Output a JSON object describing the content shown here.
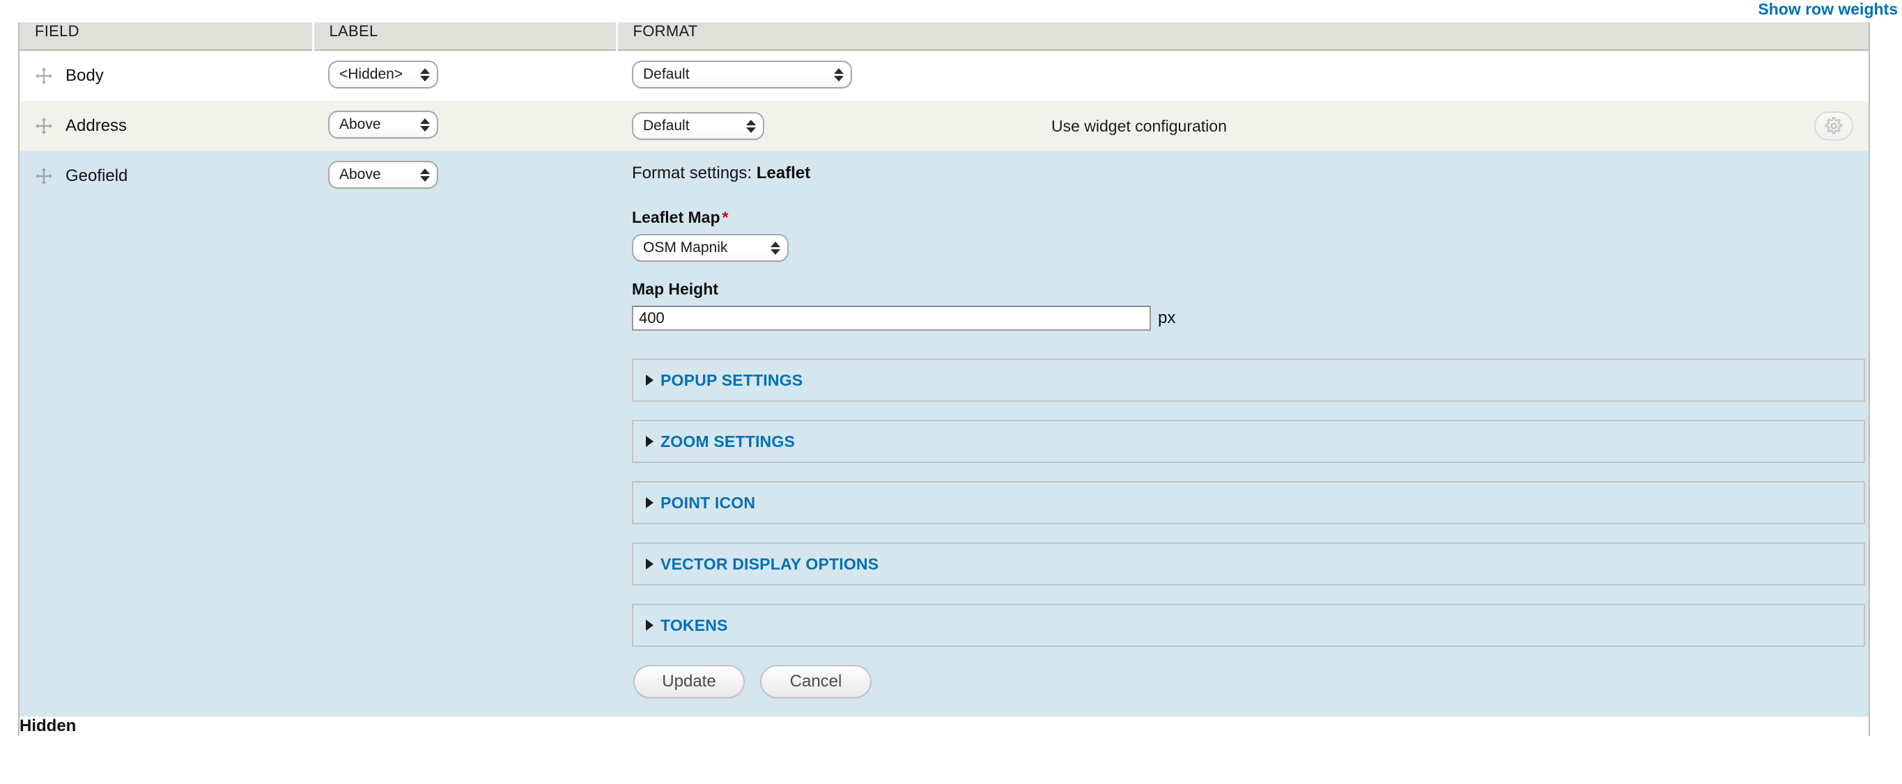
{
  "toolbar": {
    "show_row_weights_label": "Show row weights"
  },
  "table": {
    "columns": {
      "field": "FIELD",
      "label": "LABEL",
      "format": "FORMAT"
    },
    "rows": [
      {
        "name": "Body",
        "label_select_value": "<Hidden>",
        "format_select_value": "Default"
      },
      {
        "name": "Address",
        "label_select_value": "Above",
        "format_select_value": "Default",
        "summary": "Use widget configuration",
        "settings_icon": "gear-icon"
      },
      {
        "name": "Geofield",
        "label_select_value": "Above"
      }
    ],
    "hidden_section_title": "Hidden"
  },
  "geofield_settings": {
    "heading_prefix": "Format settings:",
    "heading_formatter": "Leaflet",
    "leaflet_map": {
      "label": "Leaflet Map",
      "required_mark": "*",
      "value": "OSM Mapnik"
    },
    "map_height": {
      "label": "Map Height",
      "value": "400",
      "unit": "px"
    },
    "fieldsets": [
      {
        "title": "POPUP SETTINGS",
        "marker": "triangle-right-icon"
      },
      {
        "title": "ZOOM SETTINGS",
        "marker": "triangle-right-icon"
      },
      {
        "title": "POINT ICON",
        "marker": "triangle-right-icon"
      },
      {
        "title": "VECTOR DISPLAY OPTIONS",
        "marker": "triangle-right-icon"
      },
      {
        "title": "TOKENS",
        "marker": "triangle-right-icon"
      }
    ],
    "actions": {
      "update_label": "Update",
      "cancel_label": "Cancel"
    }
  },
  "colors": {
    "link_blue": "#0071b3",
    "header_gray": "#e0e0db",
    "row_alt_gray": "#f2f2ec",
    "row_active_blue": "#d6e6ef",
    "required_red": "#d0021b"
  }
}
